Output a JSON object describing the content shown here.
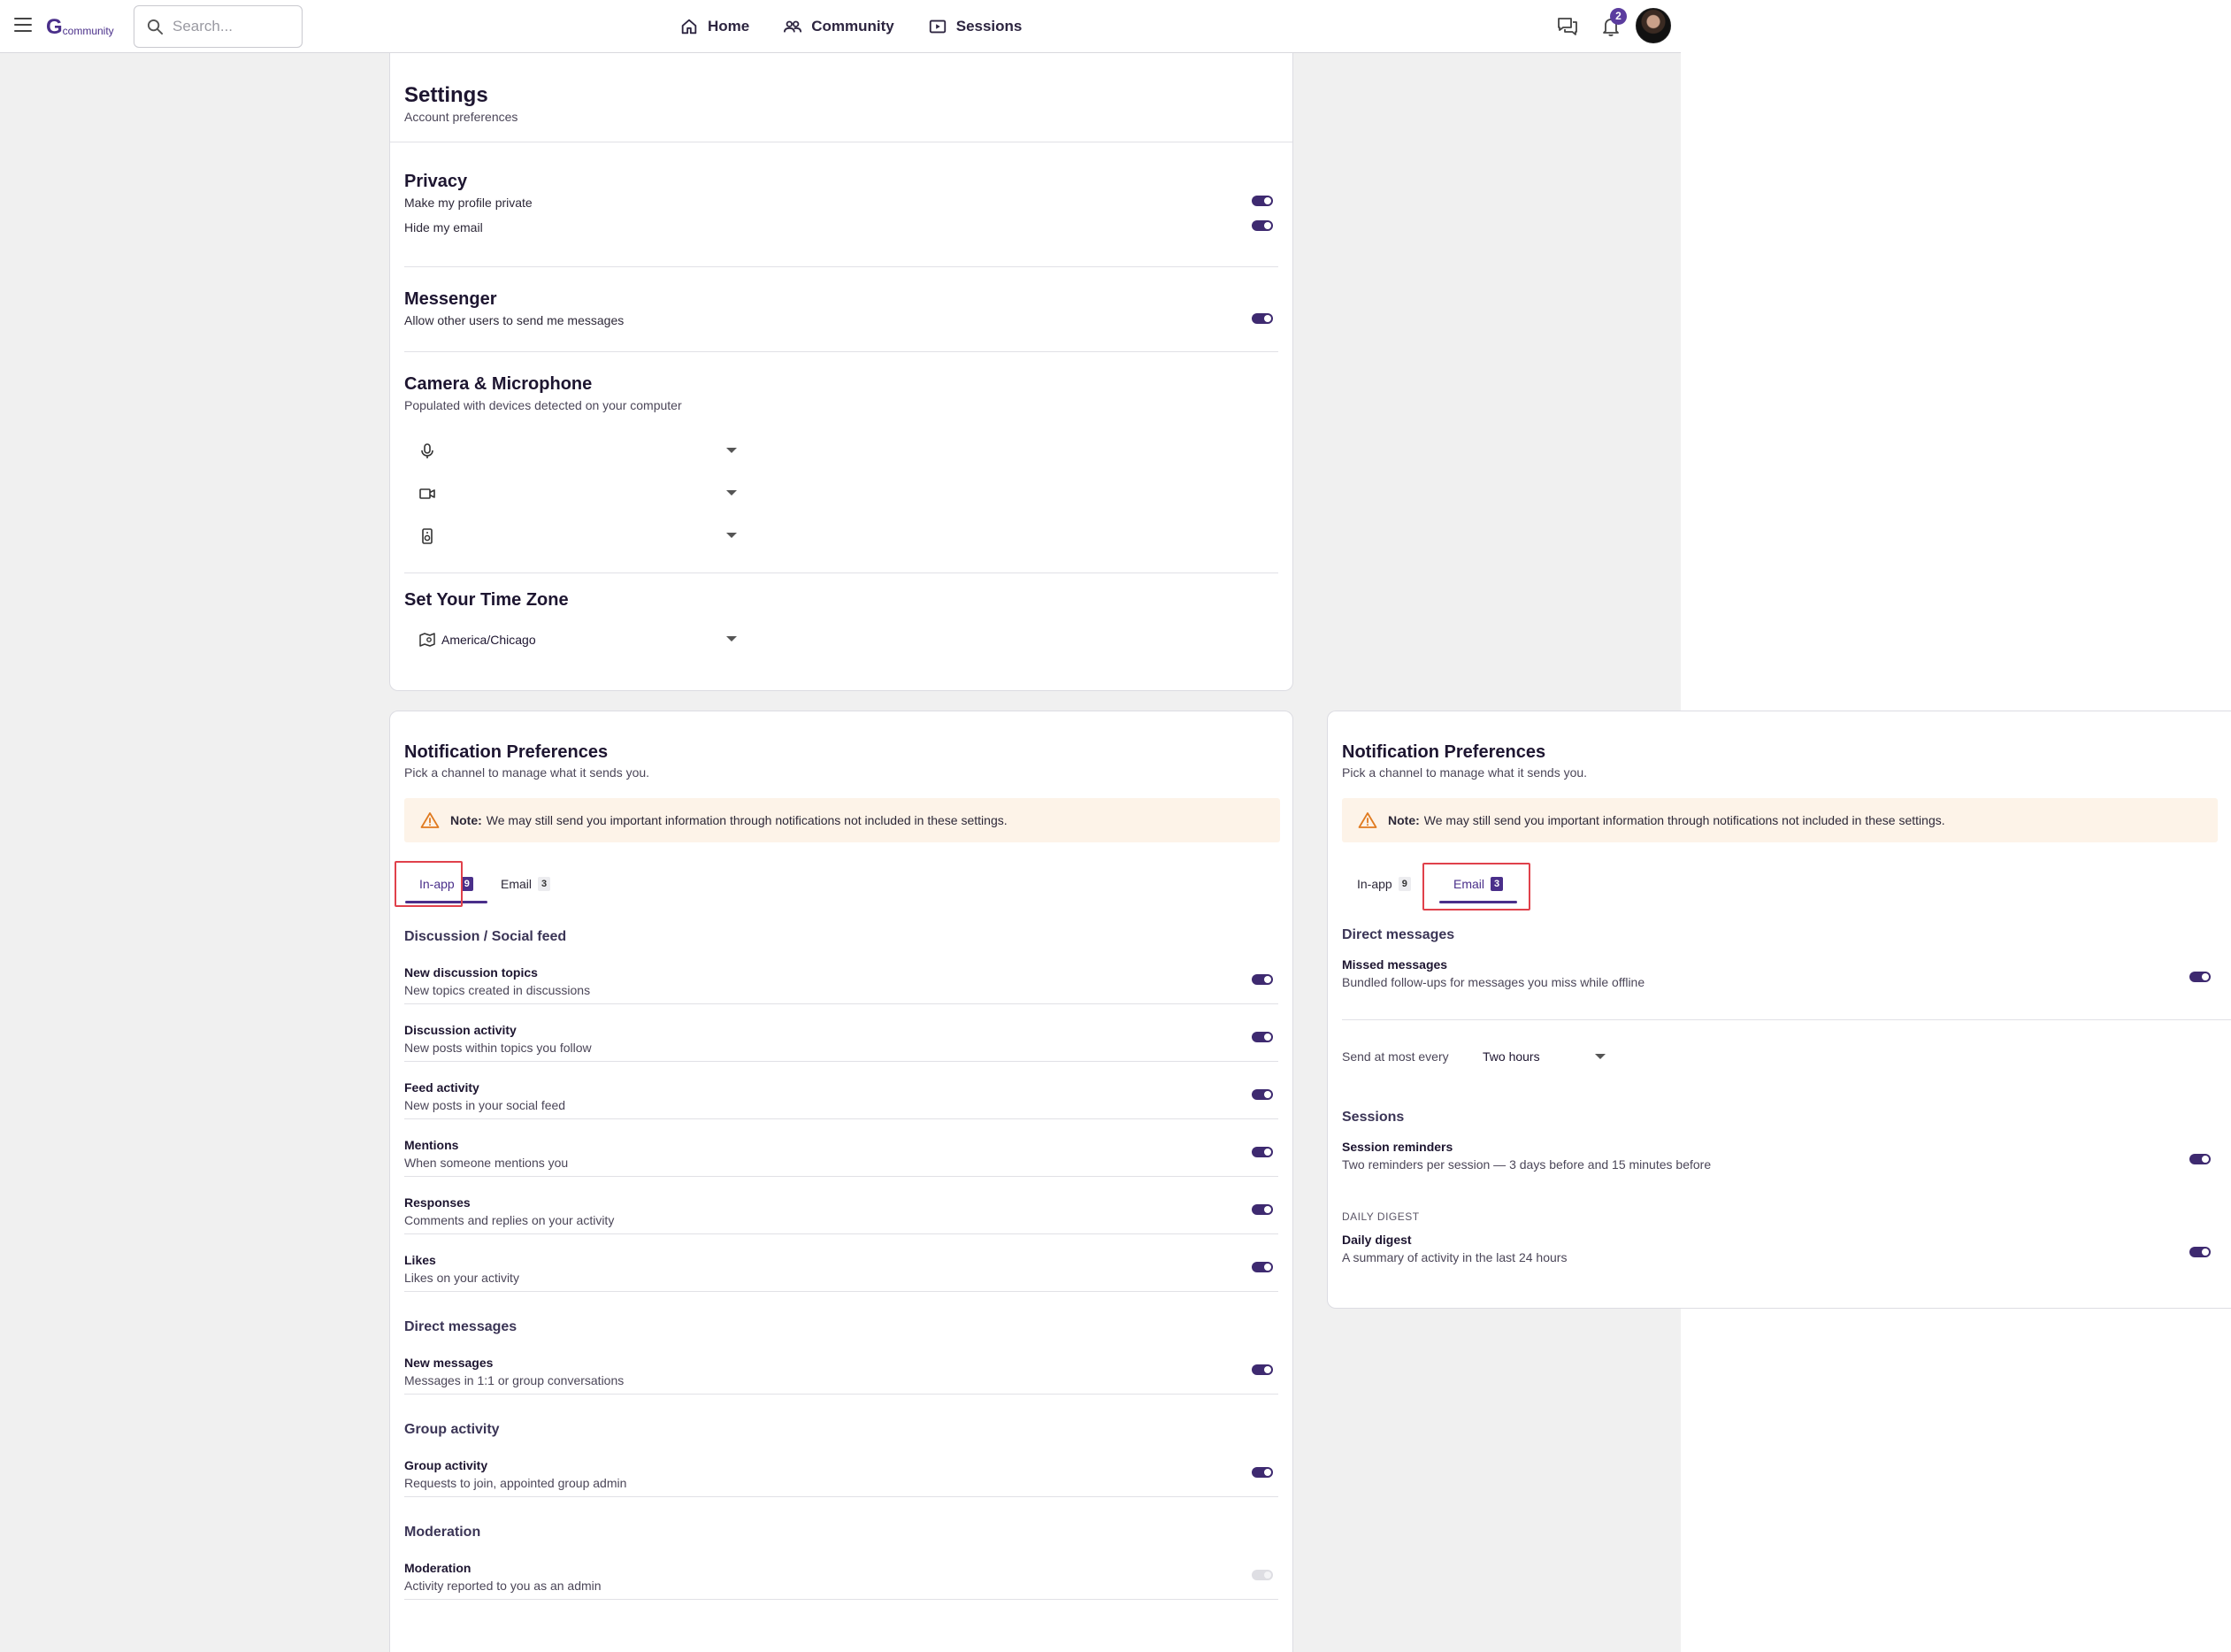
{
  "header": {
    "logo_mark": "G",
    "logo_text": "community",
    "search_placeholder": "Search...",
    "nav": [
      {
        "label": "Home",
        "icon": "home-icon"
      },
      {
        "label": "Community",
        "icon": "people-icon"
      },
      {
        "label": "Sessions",
        "icon": "play-icon"
      }
    ],
    "notifications_count": "2"
  },
  "settings": {
    "title": "Settings",
    "subtitle": "Account preferences",
    "privacy": {
      "title": "Privacy",
      "items": [
        {
          "label": "Make my profile private",
          "on": true
        },
        {
          "label": "Hide my email",
          "on": true
        }
      ]
    },
    "messenger": {
      "title": "Messenger",
      "label": "Allow other users to send me messages",
      "on": true
    },
    "devices": {
      "title": "Camera & Microphone",
      "subtitle": "Populated with devices detected on your computer"
    },
    "timezone": {
      "title": "Set Your Time Zone",
      "value": "America/Chicago"
    }
  },
  "notif_a": {
    "title": "Notification Preferences",
    "subtitle": "Pick a channel to manage what it sends you.",
    "note_bold": "Note:",
    "note_text": "We may still send you important information through notifications not included in these settings.",
    "tabs": [
      {
        "label": "In-app",
        "count": "9",
        "active": true
      },
      {
        "label": "Email",
        "count": "3",
        "active": false
      }
    ],
    "groups": [
      {
        "heading": "Discussion / Social feed",
        "rows": [
          {
            "title": "New discussion topics",
            "desc": "New topics created in discussions",
            "on": true
          },
          {
            "title": "Discussion activity",
            "desc": "New posts within topics you follow",
            "on": true
          },
          {
            "title": "Feed activity",
            "desc": "New posts in your social feed",
            "on": true
          },
          {
            "title": "Mentions",
            "desc": "When someone mentions you",
            "on": true
          },
          {
            "title": "Responses",
            "desc": "Comments and replies on your activity",
            "on": true
          },
          {
            "title": "Likes",
            "desc": "Likes on your activity",
            "on": true
          }
        ]
      },
      {
        "heading": "Direct messages",
        "rows": [
          {
            "title": "New messages",
            "desc": "Messages in 1:1 or group conversations",
            "on": true
          }
        ]
      },
      {
        "heading": "Group activity",
        "rows": [
          {
            "title": "Group activity",
            "desc": "Requests to join, appointed group admin",
            "on": true
          }
        ]
      },
      {
        "heading": "Moderation",
        "rows": [
          {
            "title": "Moderation",
            "desc": "Activity reported to you as an admin",
            "on": false
          }
        ]
      }
    ]
  },
  "notif_b": {
    "title": "Notification Preferences",
    "subtitle": "Pick a channel to manage what it sends you.",
    "note_bold": "Note:",
    "note_text": "We may still send you important information through notifications not included in these settings.",
    "tabs": [
      {
        "label": "In-app",
        "count": "9",
        "active": false
      },
      {
        "label": "Email",
        "count": "3",
        "active": true
      }
    ],
    "direct": {
      "heading": "Direct messages",
      "title": "Missed messages",
      "desc": "Bundled follow-ups for messages you miss while offline",
      "on": true
    },
    "frequency": {
      "label": "Send at most every",
      "value": "Two hours"
    },
    "sessions": {
      "heading": "Sessions",
      "title": "Session reminders",
      "desc": "Two reminders per session — 3 days before and 15 minutes before",
      "on": true
    },
    "digest": {
      "caps": "DAILY DIGEST",
      "title": "Daily digest",
      "desc": "A summary of activity in the last 24 hours",
      "on": true
    }
  },
  "colors": {
    "accent": "#4a2f8a",
    "toggle_on": "#3e2a70",
    "note_bg": "#fdf3e8",
    "highlight": "#e0414b"
  }
}
